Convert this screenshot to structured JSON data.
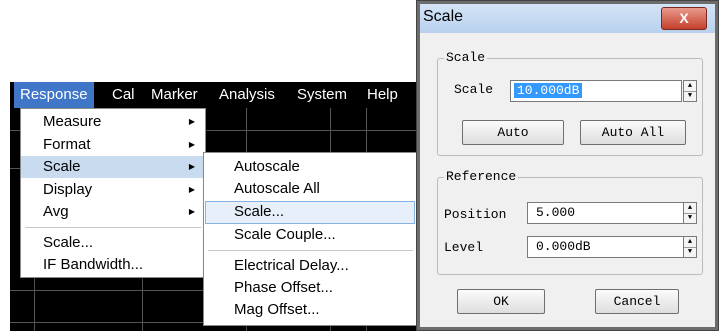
{
  "menubar": {
    "items": [
      "Response",
      "Cal",
      "Marker",
      "Analysis",
      "System",
      "Help"
    ],
    "active": "Response"
  },
  "response_menu": {
    "items": [
      "Measure",
      "Format",
      "Scale",
      "Display",
      "Avg",
      "Scale...",
      "IF Bandwidth..."
    ],
    "highlighted": "Scale"
  },
  "scale_submenu": {
    "items": [
      "Autoscale",
      "Autoscale All",
      "Scale...",
      "Scale Couple...",
      "Electrical Delay...",
      "Phase Offset...",
      "Mag Offset..."
    ],
    "hovered": "Scale..."
  },
  "dialog": {
    "title": "Scale",
    "close_glyph": "X",
    "scale_group": {
      "title": "Scale",
      "scale_label": "Scale",
      "scale_value": "10.000dB",
      "auto_label": "Auto",
      "auto_all_label": "Auto All"
    },
    "reference_group": {
      "title": "Reference",
      "position_label": "Position",
      "position_value": "5.000",
      "level_label": "Level",
      "level_value": "0.000dB"
    },
    "ok_label": "OK",
    "cancel_label": "Cancel"
  },
  "colors": {
    "menubar_bg": "#000000",
    "menubar_active": "#3f76c8",
    "submenu_highlight": "#c9dcef",
    "hover_box": "#e7f0fa",
    "selection": "#3399ff",
    "close_button": "#c4402c"
  }
}
